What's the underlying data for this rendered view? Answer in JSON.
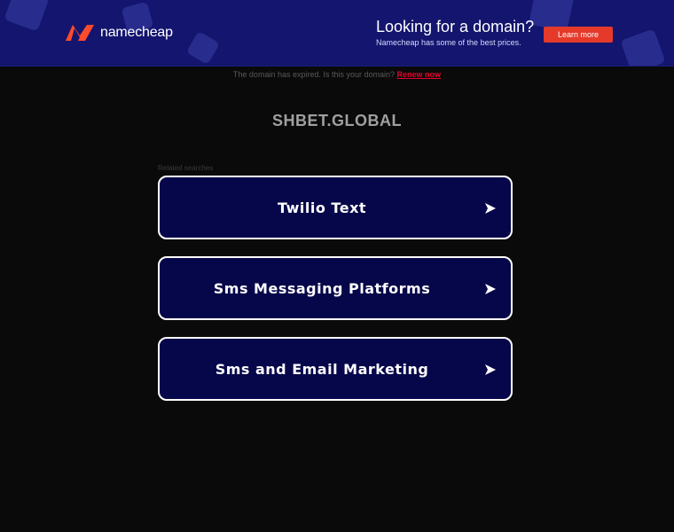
{
  "banner": {
    "brand": "namecheap",
    "promo_title": "Looking for a domain?",
    "promo_subtitle": "Namecheap has some of the best prices.",
    "learn_more": "Learn more"
  },
  "notice": {
    "text": "The domain has expired. Is this your domain?",
    "renew_link": "Renew now"
  },
  "domain": "SHBET.GLOBAL",
  "related_label": "Related searches",
  "searches": [
    {
      "label": "Twilio Text"
    },
    {
      "label": "Sms Messaging Platforms"
    },
    {
      "label": "Sms and Email Marketing"
    }
  ],
  "colors": {
    "banner_bg": "#13156e",
    "accent_red": "#e53a2a",
    "card_bg": "#06064a",
    "page_bg": "#0a0a0a"
  },
  "icons": [
    "namecheap-logo-icon",
    "arrow-right-icon"
  ]
}
